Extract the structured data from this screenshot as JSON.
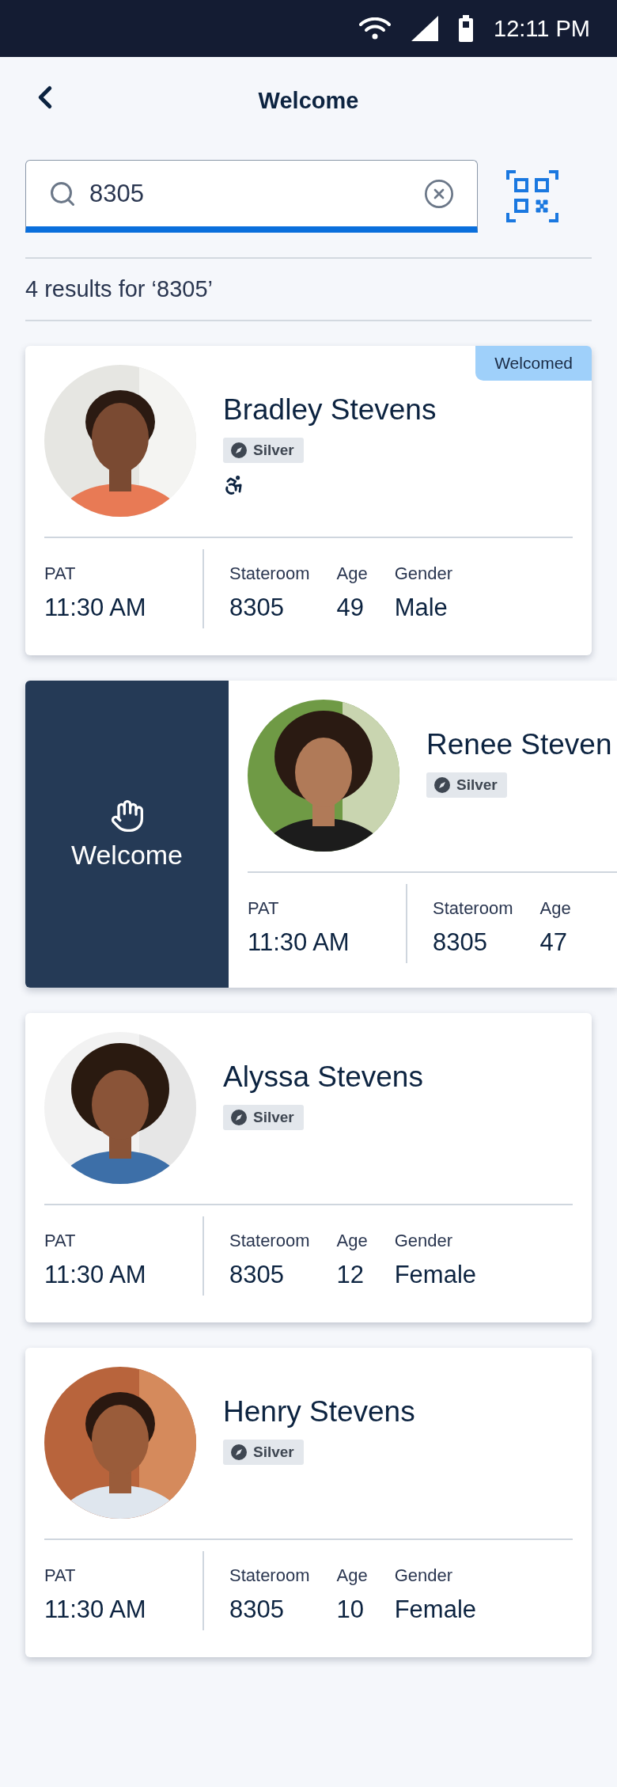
{
  "status_bar": {
    "time": "12:11 PM"
  },
  "header": {
    "title": "Welcome"
  },
  "search": {
    "value": "8305"
  },
  "results_summary": "4 results for ‘8305’",
  "guests": [
    {
      "name": "Bradley Stevens",
      "tier": "Silver",
      "status_label": "Welcomed",
      "markers": [
        {
          "kind": "wheelchair"
        }
      ],
      "stats": [
        {
          "label": "PAT",
          "value": "11:30 AM"
        },
        {
          "label": "Stateroom",
          "value": "8305"
        },
        {
          "label": "Age",
          "value": "49"
        },
        {
          "label": "Gender",
          "value": "Male"
        }
      ]
    },
    {
      "name": "Renee Steven",
      "tier": "Silver",
      "swipe_action": "Welcome",
      "stats": [
        {
          "label": "PAT",
          "value": "11:30 AM"
        },
        {
          "label": "Stateroom",
          "value": "8305"
        },
        {
          "label": "Age",
          "value": "47"
        }
      ]
    },
    {
      "name": "Alyssa Stevens",
      "tier": "Silver",
      "stats": [
        {
          "label": "PAT",
          "value": "11:30 AM"
        },
        {
          "label": "Stateroom",
          "value": "8305"
        },
        {
          "label": "Age",
          "value": "12"
        },
        {
          "label": "Gender",
          "value": "Female"
        }
      ]
    },
    {
      "name": "Henry Stevens",
      "tier": "Silver",
      "stats": [
        {
          "label": "PAT",
          "value": "11:30 AM"
        },
        {
          "label": "Stateroom",
          "value": "8305"
        },
        {
          "label": "Age",
          "value": "10"
        },
        {
          "label": "Gender",
          "value": "Female"
        }
      ]
    }
  ]
}
